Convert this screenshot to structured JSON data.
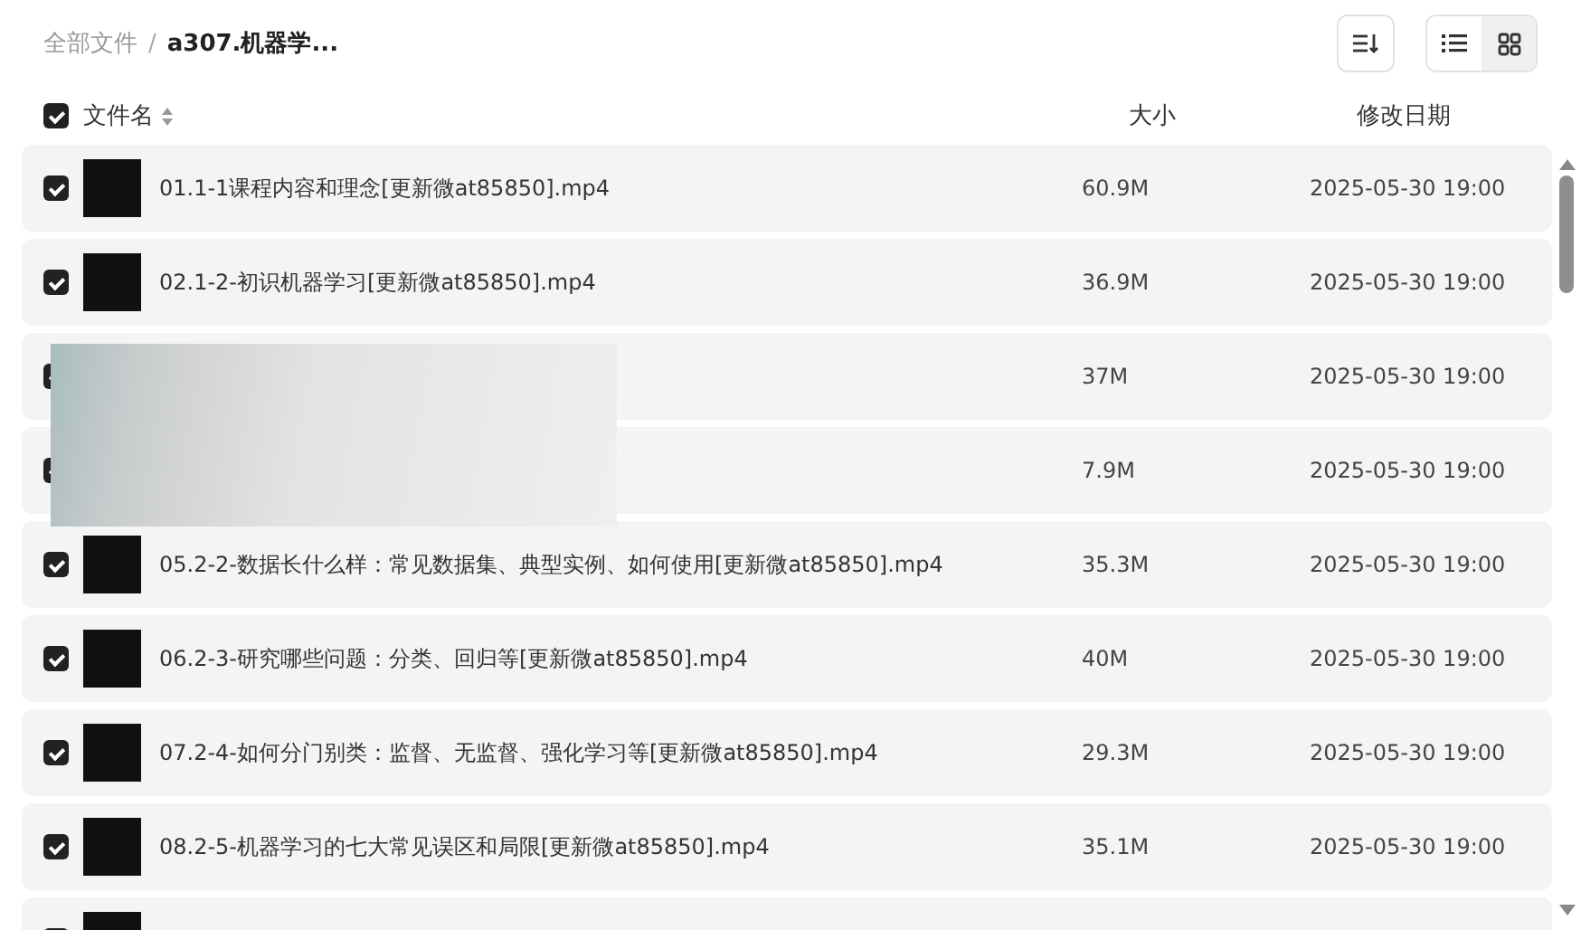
{
  "breadcrumb": {
    "separator": "/",
    "items": [
      {
        "label": "全部文件",
        "current": false
      },
      {
        "label": "a307.机器学...",
        "current": true
      }
    ]
  },
  "toolbar": {
    "views": [
      {
        "kind": "list",
        "selected": false
      },
      {
        "kind": "grid",
        "selected": true
      }
    ]
  },
  "columns": {
    "select_all": {
      "checked": true
    },
    "name": "文件名",
    "size": "大小",
    "modified": "修改日期"
  },
  "files": [
    {
      "checked": true,
      "name": "01.1-1课程内容和理念[更新微at85850].mp4",
      "size": "60.9M",
      "modified": "2025-05-30 19:00"
    },
    {
      "checked": true,
      "name": "02.1-2-初识机器学习[更新微at85850].mp4",
      "size": "36.9M",
      "modified": "2025-05-30 19:00"
    },
    {
      "checked": true,
      "size": "37M",
      "modified": "2025-05-30 19:00"
    },
    {
      "checked": true,
      "size": "7.9M",
      "modified": "2025-05-30 19:00"
    },
    {
      "checked": true,
      "name": "05.2-2-数据长什么样：常见数据集、典型实例、如何使用[更新微at85850].mp4",
      "size": "35.3M",
      "modified": "2025-05-30 19:00"
    },
    {
      "checked": true,
      "name": "06.2-3-研究哪些问题：分类、回归等[更新微at85850].mp4",
      "size": "40M",
      "modified": "2025-05-30 19:00"
    },
    {
      "checked": true,
      "name": "07.2-4-如何分门别类：监督、无监督、强化学习等[更新微at85850].mp4",
      "size": "29.3M",
      "modified": "2025-05-30 19:00"
    },
    {
      "checked": true,
      "name": "08.2-5-机器学习的七大常见误区和局限[更新微at85850].mp4",
      "size": "35.1M",
      "modified": "2025-05-30 19:00"
    },
    {
      "checked": true
    }
  ]
}
